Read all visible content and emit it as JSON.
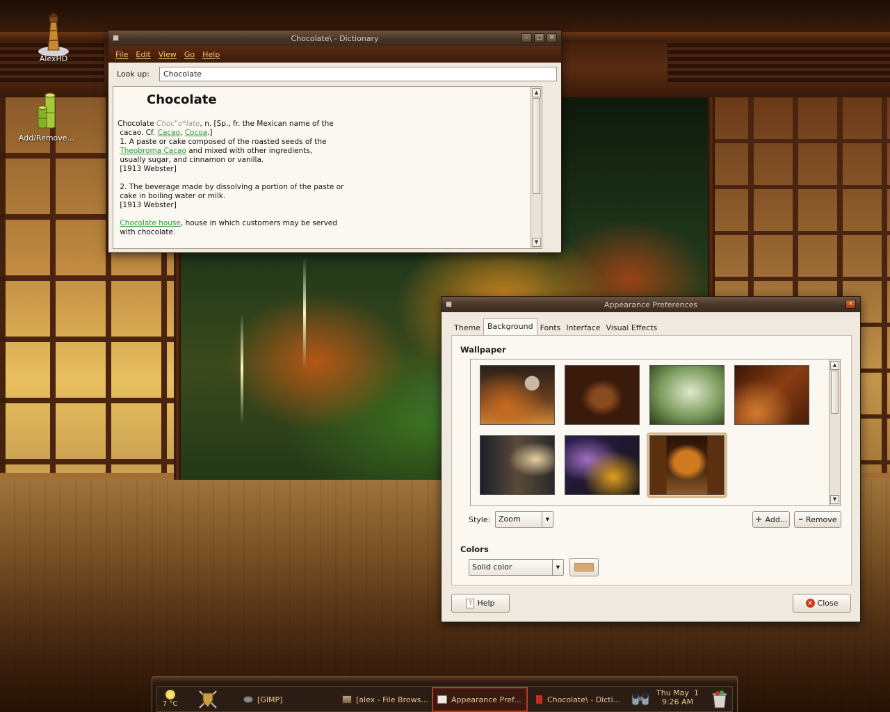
{
  "desktop": {
    "icons": [
      {
        "label": "AlexHD",
        "icon": "lighthouse-icon"
      },
      {
        "label": "Add/Remove...",
        "icon": "bamboo-icon"
      }
    ]
  },
  "dictionary_window": {
    "title": "Chocolate\\ - Dictionary",
    "menu": [
      "File",
      "Edit",
      "View",
      "Go",
      "Help"
    ],
    "lookup_label": "Look up:",
    "lookup_value": "Chocolate",
    "headword": "Chocolate",
    "entry": {
      "term": "Chocolate",
      "pronunciation": "Choc\"o*late",
      "pos_etym_1": ", n. [Sp., fr. the Mexican name of the",
      "etym_2": " cacao. Cf. ",
      "link_cacao": "Cacao",
      "comma": ", ",
      "link_cocoa": "Cocoa",
      "etym_end": ".]",
      "sense1_line1": " 1. A paste or cake composed of the roasted seeds of the",
      "link_theobroma": "Theobroma Cacao",
      "sense1_line2": " and mixed with other ingredients,",
      "sense1_line3": " usually sugar, and cinnamon or vanilla.",
      "source1": " [1913 Webster]",
      "sense2_line1": " 2. The beverage made by dissolving a portion of the paste or",
      "sense2_line2": " cake in boiling water or milk.",
      "source2": " [1913 Webster]",
      "link_house": "Chocolate house",
      "house_line1": ", house in which customers may be served",
      "house_line2": " with chocolate."
    }
  },
  "appearance_window": {
    "title": "Appearance Preferences",
    "tabs": [
      "Theme",
      "Background",
      "Fonts",
      "Interface",
      "Visual Effects"
    ],
    "active_tab": "Background",
    "wallpaper_label": "Wallpaper",
    "style_label": "Style:",
    "style_value": "Zoom",
    "add_label": "Add...",
    "remove_label": "Remove",
    "colors_label": "Colors",
    "colors_value": "Solid color",
    "swatch_color": "#d8a874",
    "help_label": "Help",
    "close_label": "Close"
  },
  "taskbar": {
    "weather_temp": "7 °C",
    "items": [
      {
        "label": "[GIMP]"
      },
      {
        "label": "[alex - File Brows..."
      },
      {
        "label": "Appearance Pref..."
      },
      {
        "label": "Chocolate\\ - Dicti..."
      }
    ],
    "clock_date": "Thu May  1",
    "clock_time": "9:26 AM"
  }
}
